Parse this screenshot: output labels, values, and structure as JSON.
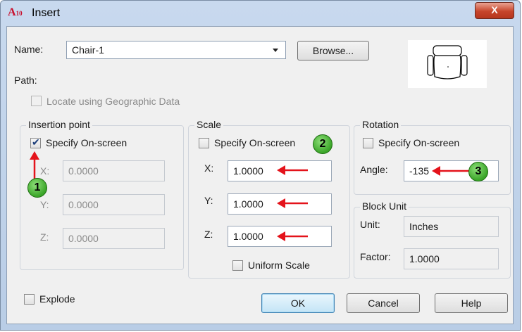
{
  "window": {
    "title": "Insert",
    "close_label": "X",
    "app_icon_text": "A",
    "app_icon_sub": "10"
  },
  "name": {
    "label": "Name:",
    "value": "Chair-1",
    "browse_label": "Browse..."
  },
  "path": {
    "label": "Path:"
  },
  "geo": {
    "label": "Locate using Geographic Data",
    "checked": false,
    "enabled": false
  },
  "insertion_point": {
    "title": "Insertion point",
    "specify_label": "Specify On-screen",
    "specify_checked": true,
    "x_label": "X:",
    "x_value": "0.0000",
    "y_label": "Y:",
    "y_value": "0.0000",
    "z_label": "Z:",
    "z_value": "0.0000"
  },
  "scale": {
    "title": "Scale",
    "specify_label": "Specify On-screen",
    "specify_checked": false,
    "x_label": "X:",
    "x_value": "1.0000",
    "y_label": "Y:",
    "y_value": "1.0000",
    "z_label": "Z:",
    "z_value": "1.0000",
    "uniform_label": "Uniform Scale",
    "uniform_checked": false
  },
  "rotation": {
    "title": "Rotation",
    "specify_label": "Specify On-screen",
    "specify_checked": false,
    "angle_label": "Angle:",
    "angle_value": "-135"
  },
  "block_unit": {
    "title": "Block Unit",
    "unit_label": "Unit:",
    "unit_value": "Inches",
    "factor_label": "Factor:",
    "factor_value": "1.0000"
  },
  "explode": {
    "label": "Explode",
    "checked": false
  },
  "buttons": {
    "ok": "OK",
    "cancel": "Cancel",
    "help": "Help"
  },
  "callouts": [
    "1",
    "2",
    "3"
  ],
  "colors": {
    "callout": "#3aa528",
    "arrow": "#e4131b",
    "close": "#c7452b"
  },
  "icons": [
    "autocad-app-icon",
    "close-icon",
    "dropdown-arrow-icon",
    "chair-preview-icon",
    "checkmark-icon",
    "red-arrow-icon"
  ]
}
